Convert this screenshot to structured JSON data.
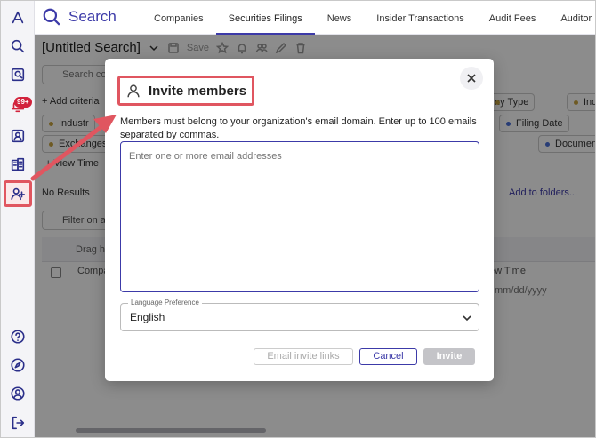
{
  "app": {
    "search_label": "Search",
    "tabs": [
      {
        "label": "Companies"
      },
      {
        "label": "Securities Filings"
      },
      {
        "label": "News"
      },
      {
        "label": "Insider Transactions"
      },
      {
        "label": "Audit Fees"
      },
      {
        "label": "Auditor"
      }
    ],
    "active_tab": "Securities Filings",
    "alerts_badge": "99+"
  },
  "search": {
    "title": "[Untitled Search]",
    "save_label": "Save",
    "search_placeholder": "Search co",
    "add_criteria": "+ Add criteria",
    "chips_left": [
      "Industr",
      "Exchanges",
      "+ View Time"
    ],
    "chips_right": [
      "ny Type",
      "Ind",
      "Filing Date",
      "Document"
    ],
    "no_results": "No Results",
    "add_to_folders": "Add to folders...",
    "filter_placeholder": "Filter on a",
    "drag_hint": "Drag he",
    "col_company": "Compa",
    "col_view_time": "ew Time",
    "date_placeholder": "mm/dd/yyyy"
  },
  "dialog": {
    "title": "Invite members",
    "description": "Members must belong to your organization's email domain. Enter up to 100 emails separated by commas.",
    "email_placeholder": "Enter one or more email addresses",
    "language_label": "Language Preference",
    "language_value": "English",
    "buttons": {
      "email_invite_links": "Email invite links",
      "cancel": "Cancel",
      "invite": "Invite"
    }
  },
  "colors": {
    "brand": "#3c3aa8",
    "annotation": "#e05660",
    "badge": "#d2233c"
  }
}
